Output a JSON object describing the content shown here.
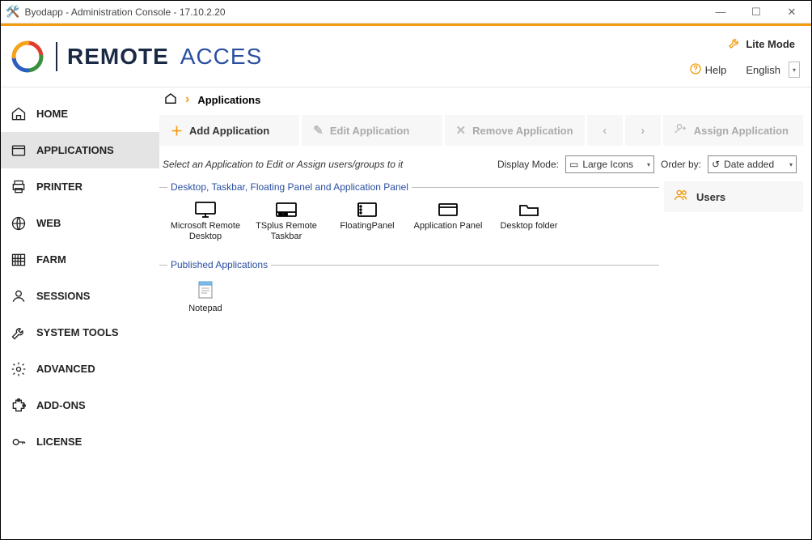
{
  "window": {
    "title": "Byodapp - Administration Console - 17.10.2.20"
  },
  "header": {
    "brand_left": "REMOTE",
    "brand_right": "ACCES",
    "lite_mode_label": "Lite Mode",
    "help_label": "Help",
    "language_value": "English"
  },
  "sidebar": {
    "items": [
      {
        "id": "home",
        "label": "HOME"
      },
      {
        "id": "applications",
        "label": "APPLICATIONS"
      },
      {
        "id": "printer",
        "label": "PRINTER"
      },
      {
        "id": "web",
        "label": "WEB"
      },
      {
        "id": "farm",
        "label": "FARM"
      },
      {
        "id": "sessions",
        "label": "SESSIONS"
      },
      {
        "id": "systemtools",
        "label": "SYSTEM TOOLS"
      },
      {
        "id": "advanced",
        "label": "ADVANCED"
      },
      {
        "id": "addons",
        "label": "ADD-ONS"
      },
      {
        "id": "license",
        "label": "LICENSE"
      }
    ],
    "active_index": 1
  },
  "breadcrumb": {
    "current": "Applications"
  },
  "toolbar": {
    "add_label": "Add Application",
    "edit_label": "Edit Application",
    "remove_label": "Remove Application",
    "assign_label": "Assign Application"
  },
  "filter": {
    "hint": "Select an Application to Edit or Assign users/groups to it",
    "display_mode_label": "Display Mode:",
    "display_mode_value": "Large Icons",
    "order_by_label": "Order by:",
    "order_by_value": "Date added"
  },
  "groups": {
    "builtin_legend": "Desktop, Taskbar, Floating Panel and Application Panel",
    "published_legend": "Published Applications",
    "builtin": [
      {
        "label": "Microsoft Remote Desktop"
      },
      {
        "label": "TSplus Remote Taskbar"
      },
      {
        "label": "FloatingPanel"
      },
      {
        "label": "Application Panel"
      },
      {
        "label": "Desktop folder"
      }
    ],
    "published": [
      {
        "label": "Notepad"
      }
    ]
  },
  "right": {
    "users_label": "Users"
  }
}
